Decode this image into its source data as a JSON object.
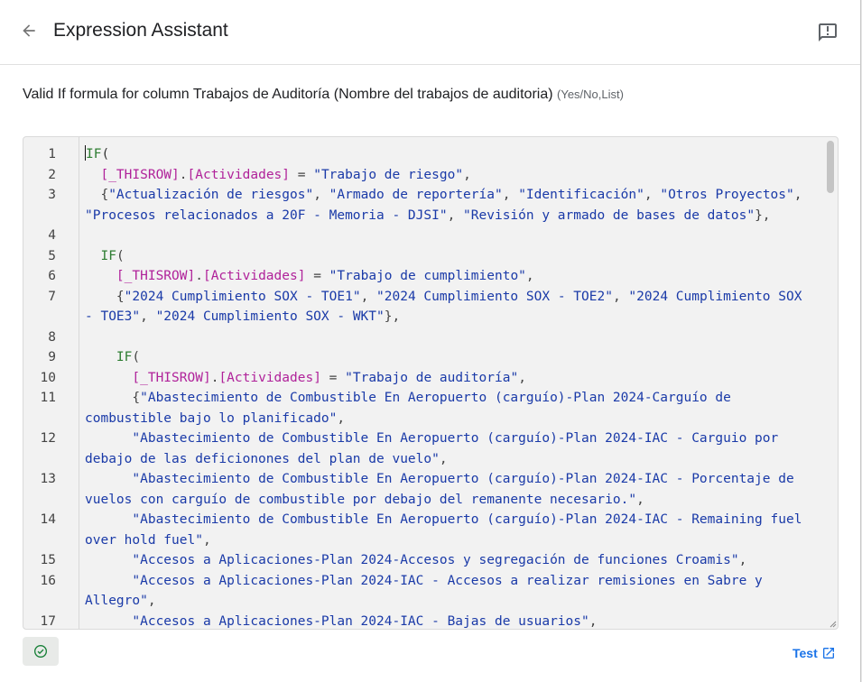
{
  "header": {
    "title": "Expression Assistant"
  },
  "description": {
    "text": "Valid If formula for column Trabajos de Auditoría (Nombre del trabajos de auditoria)",
    "types": "(Yes/No,List)"
  },
  "editor": {
    "line_numbers": [
      "1",
      "2",
      "3",
      "4",
      "5",
      "6",
      "7",
      "8",
      "9",
      "10",
      "11",
      "12",
      "13",
      "14",
      "15",
      "16",
      "17"
    ]
  },
  "footer": {
    "test_label": "Test"
  },
  "colors": {
    "accent": "#1a73e8",
    "keyword": "#2e7d32",
    "reference": "#b0229a",
    "string": "#1a3aa8",
    "valid": "#188038"
  },
  "icons": [
    "arrow-back-icon",
    "feedback-icon",
    "check-circle-icon",
    "open-in-new-icon"
  ]
}
